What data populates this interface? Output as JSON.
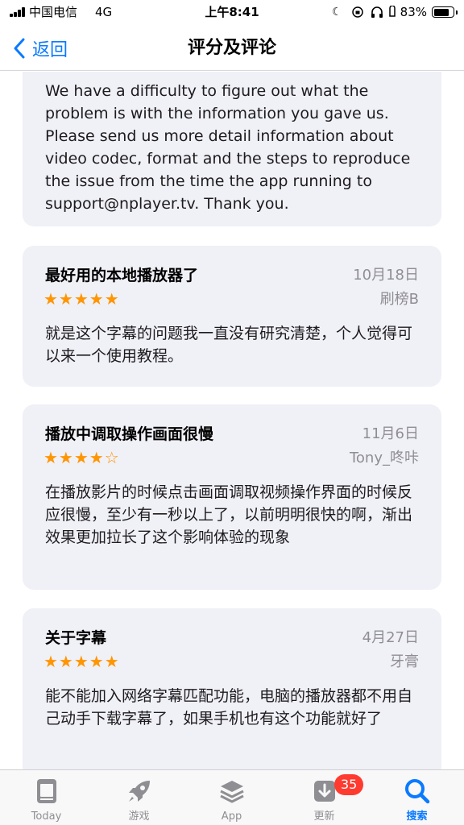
{
  "status_bar": {
    "carrier": "中国电信",
    "network": "4G",
    "time": "上午8:41",
    "battery_percent": "83%",
    "battery_level": 0.83,
    "icons": [
      "moon-icon",
      "orientation-lock-icon",
      "headphones-icon"
    ]
  },
  "nav": {
    "back_label": "返回",
    "title": "评分及评论"
  },
  "developer_reply": {
    "text": "We have a difficulty to figure out what the problem is with the information you gave us. Please send us more detail information about video codec, format and the steps to reproduce the issue from the time the app running to support@nplayer.tv. Thank you."
  },
  "reviews": [
    {
      "title": "最好用的本地播放器了",
      "date": "10月18日",
      "author": "刷榜B",
      "stars": "★★★★★",
      "rating": 5,
      "body": "就是这个字幕的问题我一直没有研究清楚，个人觉得可以来一个使用教程。"
    },
    {
      "title": "播放中调取操作画面很慢",
      "date": "11月6日",
      "author": "Tony_咚咔",
      "stars": "★★★★☆",
      "rating": 4,
      "body": "在播放影片的时候点击画面调取视频操作界面的时候反应很慢，至少有一秒以上了，以前明明很快的啊，渐出效果更加拉长了这个影响体验的现象"
    },
    {
      "title": "关于字幕",
      "date": "4月27日",
      "author": "牙膏",
      "stars": "★★★★★",
      "rating": 5,
      "body": "能不能加入网络字幕匹配功能，电脑的播放器都不用自己动手下载字幕了，如果手机也有这个功能就好了"
    }
  ],
  "tabs": [
    {
      "label": "Today",
      "icon": "today-icon",
      "active": false
    },
    {
      "label": "游戏",
      "icon": "rocket-icon",
      "active": false
    },
    {
      "label": "App",
      "icon": "app-stack-icon",
      "active": false
    },
    {
      "label": "更新",
      "icon": "updates-download-icon",
      "active": false,
      "badge": "35"
    },
    {
      "label": "搜索",
      "icon": "search-icon",
      "active": true
    }
  ],
  "colors": {
    "accent": "#0a7aff",
    "star": "#ff9500",
    "badge": "#ff3b30",
    "card_bg": "#f0f0f7",
    "secondary_text": "#8e8e93"
  }
}
